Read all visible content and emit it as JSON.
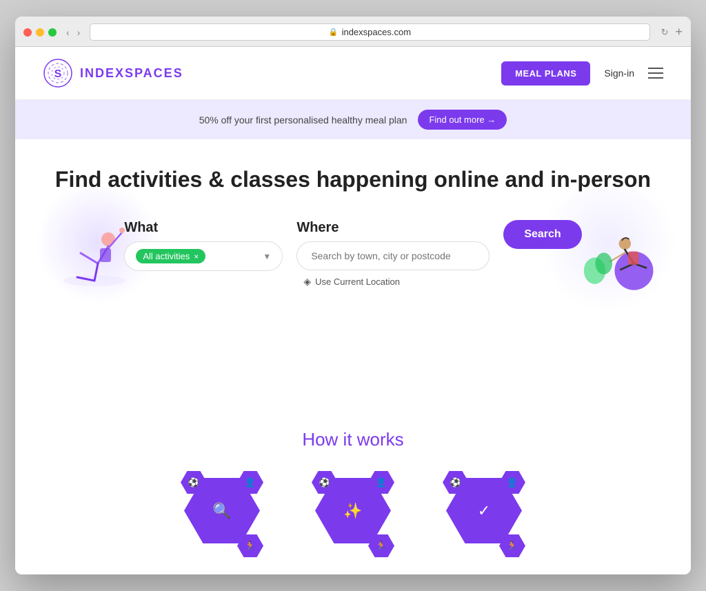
{
  "browser": {
    "url": "indexspaces.com",
    "back_btn": "‹",
    "forward_btn": "›",
    "refresh_btn": "↻",
    "new_tab_btn": "+"
  },
  "header": {
    "logo_text": "INDEXSPACES",
    "meal_plans_label": "MEAL PLANS",
    "signin_label": "Sign-in"
  },
  "banner": {
    "text": "50% off your first personalised healthy meal plan",
    "cta_label": "Find out more →"
  },
  "hero": {
    "title": "Find activities & classes happening online and in-person",
    "what_label": "What",
    "activity_tag": "All activities",
    "where_label": "Where",
    "where_placeholder": "Search by town, city or postcode",
    "use_location_label": "Use Current Location",
    "search_label": "Search"
  },
  "how_it_works": {
    "title": "How it works",
    "steps": [
      {
        "icon": "🔍",
        "top_icon": "👤",
        "side_icon": "⚽"
      },
      {
        "icon": "✨",
        "top_icon": "👤",
        "side_icon": "⚽"
      },
      {
        "icon": "✓",
        "top_icon": "👤",
        "side_icon": "⚽"
      }
    ]
  }
}
